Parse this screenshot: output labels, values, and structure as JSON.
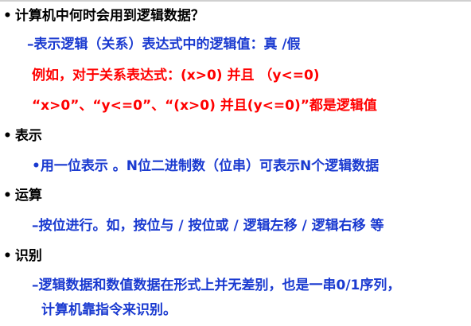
{
  "slide": {
    "sections": [
      {
        "bullet": "•",
        "heading": "计算机中何时会用到逻辑数据？",
        "lines": [
          {
            "text": "–表示逻辑（关系）表达式中的逻辑值：真 /假"
          },
          {
            "text": "例如，对于关系表达式：(x>0) 并且 （y<=0)"
          },
          {
            "text": "“x>0”、“y<=0”、“(x>0) 并且(y<=0)”都是逻辑值"
          }
        ]
      },
      {
        "bullet": "•",
        "heading": "表示",
        "lines": [
          {
            "text": "•用一位表示 。N位二进制数（位串）可表示N个逻辑数据"
          }
        ]
      },
      {
        "bullet": "•",
        "heading": "运算",
        "lines": [
          {
            "text": "–按位进行。如，按位与 / 按位或 / 逻辑左移 / 逻辑右移 等"
          }
        ]
      },
      {
        "bullet": "•",
        "heading": "识别",
        "lines": [
          {
            "text": "–逻辑数据和数值数据在形式上并无差别，也是一串0/1序列，"
          },
          {
            "text": "计算机靠指令来识别。"
          }
        ]
      }
    ]
  },
  "colors": {
    "heading": "#000000",
    "body_blue": "#1a3ad0",
    "example_red": "#ff0000"
  }
}
